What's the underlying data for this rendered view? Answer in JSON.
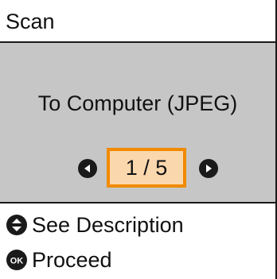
{
  "header": {
    "title": "Scan"
  },
  "main": {
    "mode_label": "To Computer (JPEG)",
    "pager": {
      "current": "1",
      "separator": "/",
      "total": "5",
      "highlight_color": "#f08a00",
      "highlight_fill": "#fbd7ad"
    }
  },
  "footer": {
    "hints": [
      {
        "icon": "up-down-arrows-icon",
        "label": "See Description"
      },
      {
        "icon": "ok-button-icon",
        "label": "Proceed",
        "icon_text": "OK"
      }
    ]
  },
  "colors": {
    "panel_background": "#c6c6c6",
    "text": "#111111"
  }
}
